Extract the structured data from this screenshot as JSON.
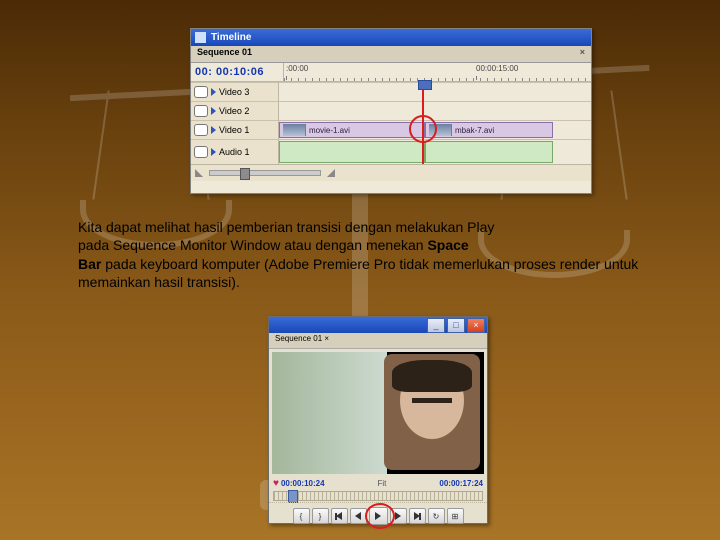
{
  "timeline": {
    "title": "Timeline",
    "sequence_tab": "Sequence 01",
    "timecode": "00: 00:10:06",
    "ruler_labels": {
      "start": ":00:00",
      "mid": "00:00:15:00"
    },
    "tracks": {
      "v3": "Video 3",
      "v2": "Video 2",
      "v1": "Video 1",
      "a1": "Audio 1"
    },
    "clips": {
      "left_name": "movie-1.avi",
      "right_name": "mbak-7.avi"
    }
  },
  "paragraph": {
    "line1a": "Kita dapat melihat hasil pemberian transisi dengan melakukan Play ",
    "line2a": "pada Sequence Monitor Window atau dengan menekan ",
    "space_bold": "Space",
    "line3_bar_bold": " Bar",
    "line3_rest": " pada keyboard komputer (Adobe Premiere Pro tidak memerlukan   proses render untuk memainkan hasil transisi)."
  },
  "monitor": {
    "tab": "Sequence 01",
    "min_btn": "_",
    "max_btn": "□",
    "close_btn": "×",
    "tc_left": "00:00:10:24",
    "tc_right": "00:00:17:24",
    "fit_label": "Fit",
    "controls": {
      "in": "{",
      "out": "}",
      "set_in": "↤",
      "step_back": "◀",
      "play": "▶",
      "step_fwd": "▶",
      "set_out": "↦",
      "loop": "↻",
      "safe": "⊞"
    }
  }
}
